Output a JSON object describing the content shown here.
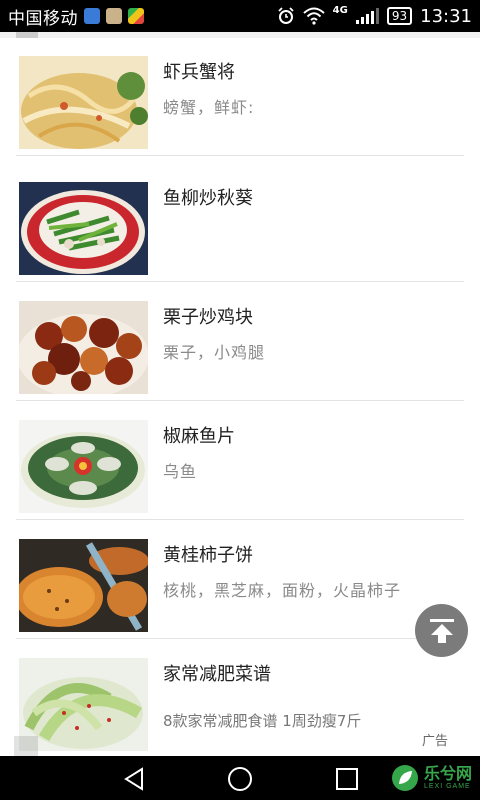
{
  "status_bar": {
    "carrier": "中国移动",
    "network_type": "4G",
    "battery": "93",
    "time": "13:31",
    "icons": [
      "app-notification-icon",
      "gallery-notification-icon",
      "play-store-icon",
      "alarm-icon",
      "wifi-icon",
      "signal-icon",
      "battery-icon"
    ]
  },
  "recipes": [
    {
      "title": "虾兵蟹将",
      "desc": "螃蟹，鲜虾:"
    },
    {
      "title": "鱼柳炒秋葵",
      "desc": ""
    },
    {
      "title": "栗子炒鸡块",
      "desc": "栗子，小鸡腿"
    },
    {
      "title": "椒麻鱼片",
      "desc": "乌鱼"
    },
    {
      "title": "黄桂柿子饼",
      "desc": "核桃，黑芝麻，面粉，火晶柿子"
    }
  ],
  "ad": {
    "title": "家常减肥菜谱",
    "desc": "8款家常减肥食谱 1周劲瘦7斤",
    "label": "广告"
  },
  "scroll_top_icon": "arrow-up-to-top-icon",
  "nav": {
    "buttons": [
      "back-icon",
      "home-icon",
      "recents-icon"
    ]
  },
  "watermark": {
    "text": "乐兮网",
    "sub": "LEXI GAME"
  },
  "colors": {
    "accent_green": "#36a64a",
    "title_text": "#222222",
    "desc_text": "#8a8a8a",
    "divider": "#e3e3e3"
  }
}
